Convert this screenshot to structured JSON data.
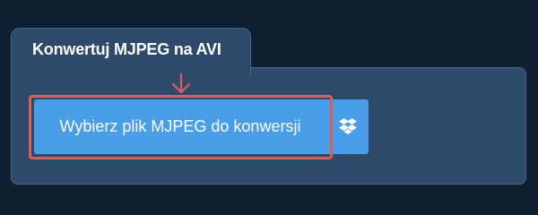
{
  "tab": {
    "title": "Konwertuj MJPEG na AVI"
  },
  "upload": {
    "button_label": "Wybierz plik MJPEG do konwersji",
    "dropbox_icon": "dropbox-icon"
  },
  "annotation": {
    "arrow_icon": "arrow-down-icon",
    "highlight_color": "#d9605a"
  },
  "colors": {
    "background": "#0f2033",
    "panel": "#2d4a6b",
    "button": "#4a9ee8",
    "text": "#ffffff"
  }
}
